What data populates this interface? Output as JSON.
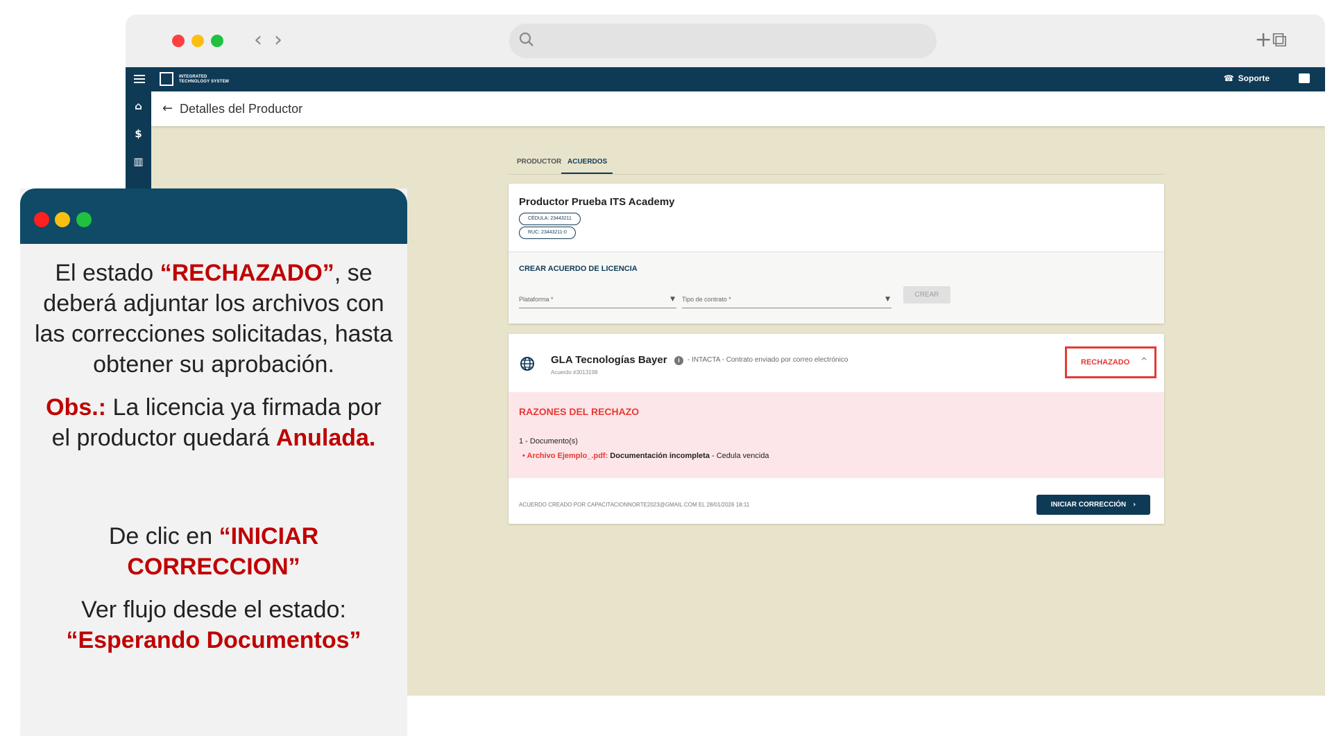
{
  "browser": {
    "tab_actions": "+⧉"
  },
  "app": {
    "logo_line1": "INTEGRATED",
    "logo_line2": "TECHNOLOGY SYSTEM",
    "support_label": "Soporte"
  },
  "page": {
    "title": "Detalles del Productor"
  },
  "tabs": [
    {
      "label": "PRODUCTOR"
    },
    {
      "label": "ACUERDOS"
    }
  ],
  "producer": {
    "name": "Productor Prueba ITS Academy",
    "cedula": "CÉDULA: 23443211",
    "ruc": "RUC: 23443211-0"
  },
  "create_agreement": {
    "title": "CREAR ACUERDO DE LICENCIA",
    "platform_placeholder": "Plataforma *",
    "contract_placeholder": "Tipo de contrato *",
    "create_label": "CREAR"
  },
  "agreement": {
    "name": "GLA Tecnologías Bayer",
    "status_note": "- INTACTA - Contrato enviado por correo electrónico",
    "number": "Acuerdo #3013198",
    "status": "RECHAZADO",
    "reject_title": "RAZONES DEL RECHAZO",
    "reject_doc": "1 - Documento(s)",
    "reject_file": "• Archivo Ejemplo_.pdf:",
    "reject_reason": "Documentación incompleta",
    "reject_detail": "- Cedula vencida",
    "footer": "ACUERDO CREADO POR CAPACITACIONNORTE2023@GMAIL.COM EL 28/01/2026 18:11",
    "start_button": "INICIAR CORRECCIÓN"
  },
  "note": {
    "p1_a": "El estado ",
    "p1_b": "“RECHAZADO”",
    "p1_c": ", se deberá adjuntar los archivos con las correcciones solicitadas, hasta obtener su aprobación.",
    "p2_a": "Obs.:",
    "p2_b": " La licencia ya firmada por el productor quedará ",
    "p2_c": "Anulada.",
    "p3_a": "De clic en ",
    "p3_b": "“INICIAR CORRECCION”",
    "p4_a": "Ver flujo desde el estado:",
    "p4_b": "“Esperando Documentos”"
  },
  "colors": {
    "primary": "#0f3a56",
    "danger": "#e53935",
    "content_bg": "#e8e4cc"
  }
}
